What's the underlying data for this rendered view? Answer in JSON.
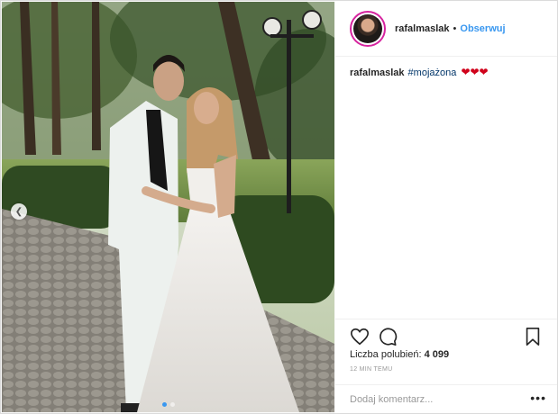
{
  "header": {
    "username": "rafalmaslak",
    "separator": "•",
    "follow_label": "Obserwuj"
  },
  "caption": {
    "username": "rafalmaslak",
    "hashtag": "#mojażona",
    "emojis": "❤❤❤"
  },
  "actions": {
    "like_icon": "heart-icon",
    "comment_icon": "comment-icon",
    "save_icon": "bookmark-icon"
  },
  "likes": {
    "label": "Liczba polubień:",
    "count": "4 099"
  },
  "timestamp": "12 MIN TEMU",
  "comment": {
    "placeholder": "Dodaj komentarz...",
    "more_label": "•••"
  },
  "carousel": {
    "prev_icon": "chevron-left-icon"
  },
  "colors": {
    "accent": "#3897f0",
    "heart": "#d0021b",
    "text": "#262626",
    "muted": "#999999"
  }
}
